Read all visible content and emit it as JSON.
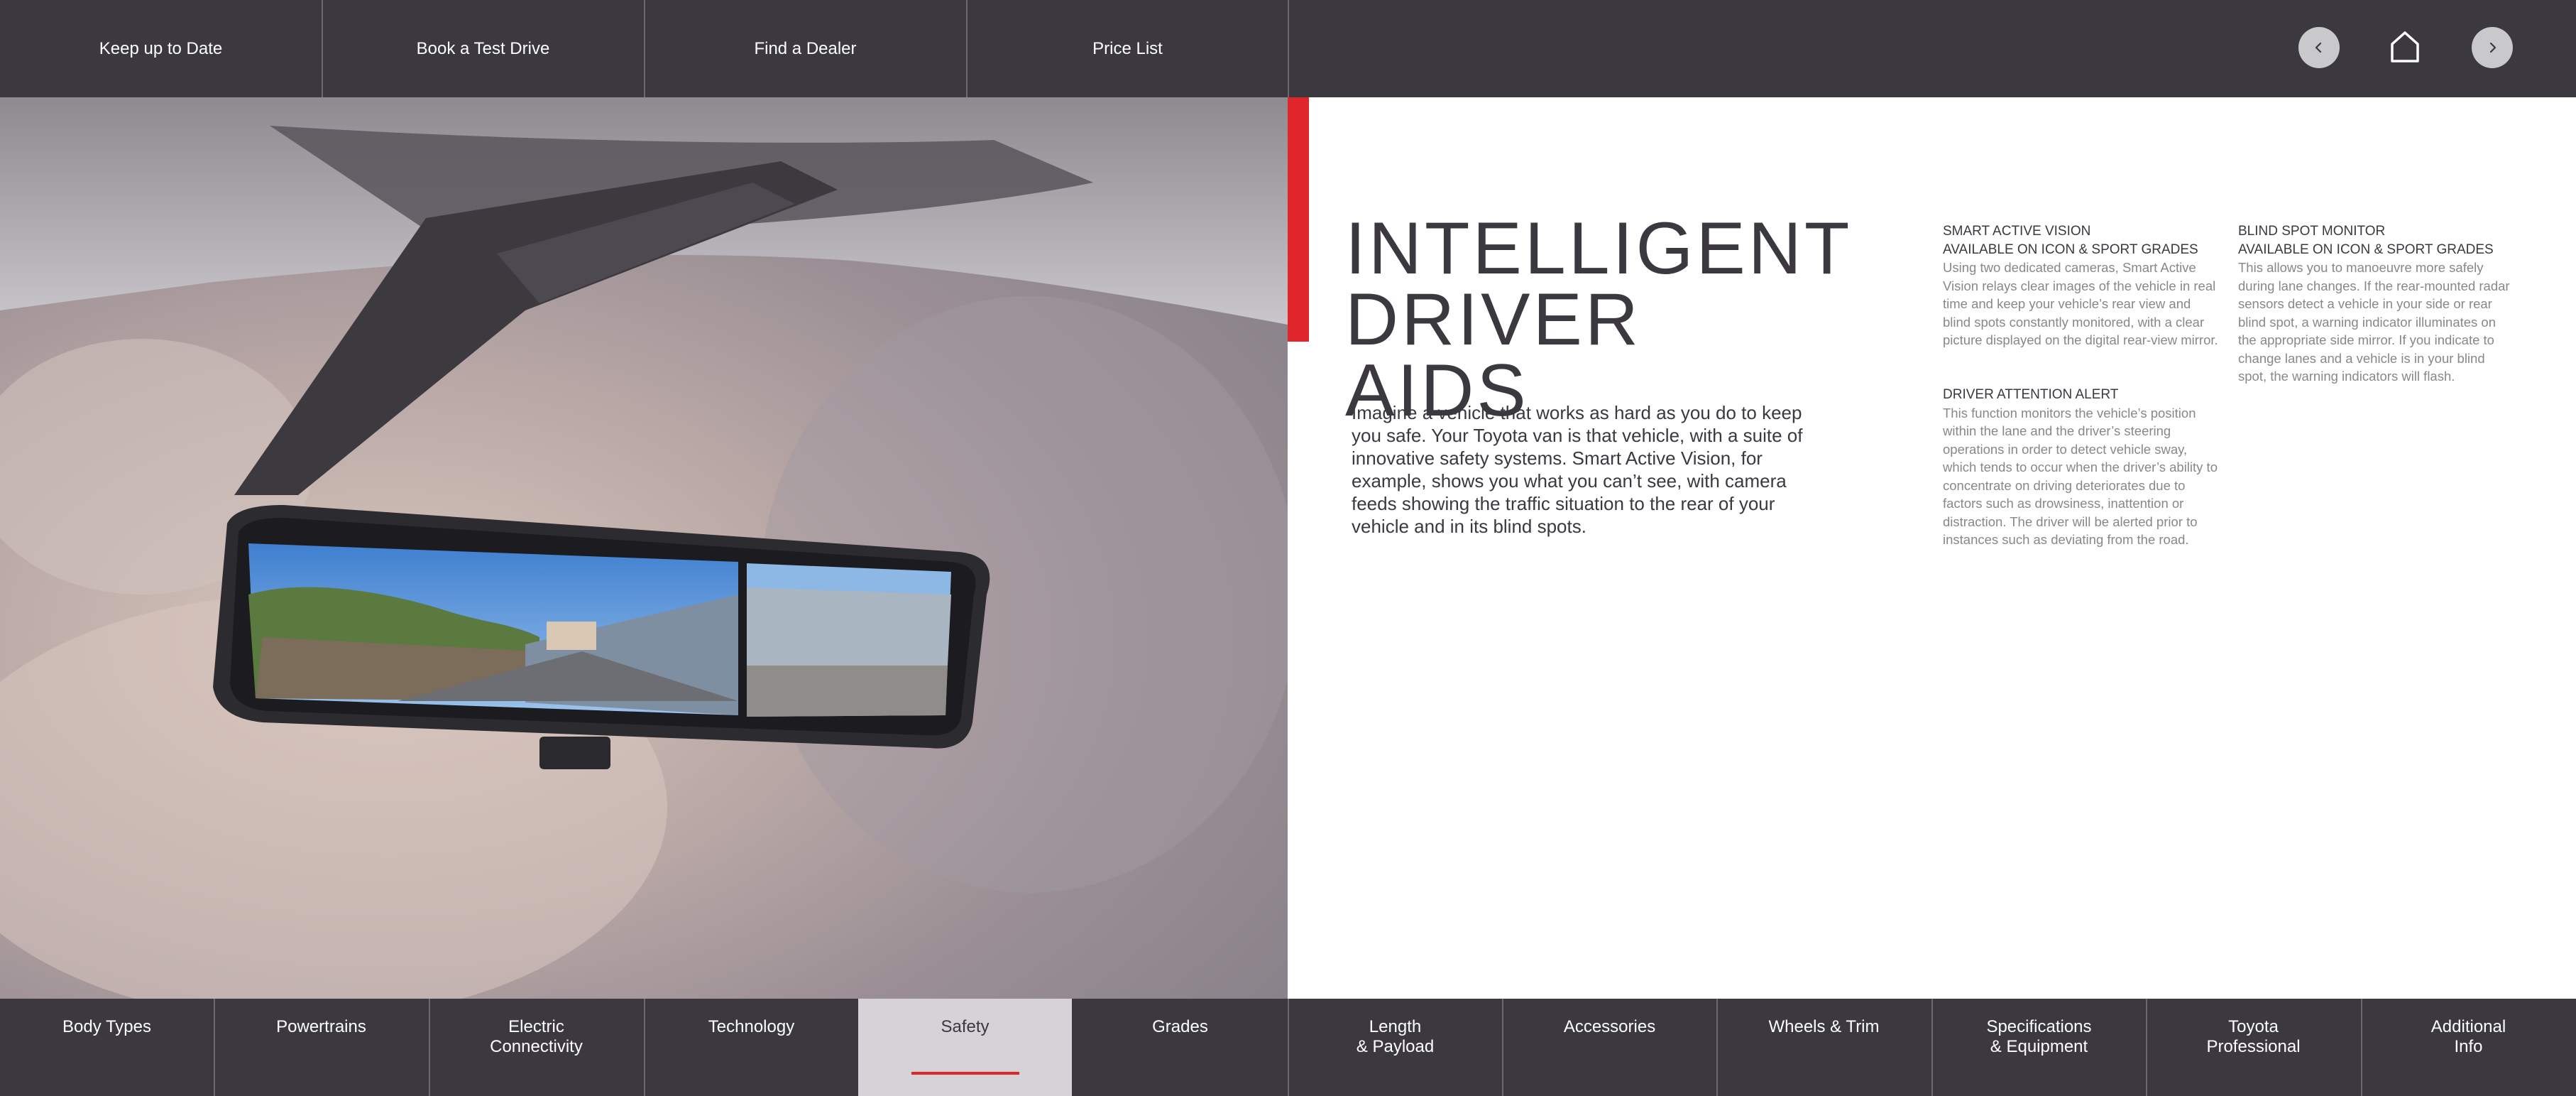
{
  "topnav": {
    "links": [
      "Keep up to Date",
      "Book a Test Drive",
      "Find a Dealer",
      "Price List"
    ]
  },
  "controls": {
    "prev_icon": "chevron-left-icon",
    "home_icon": "home-icon",
    "next_icon": "chevron-right-icon"
  },
  "colors": {
    "bar_bg": "#3b3840",
    "accent_red": "#e0262b",
    "active_tab_bg": "#d5d3d7"
  },
  "content": {
    "title_line1": "INTELLIGENT",
    "title_line2": "DRIVER AIDS",
    "intro": "Imagine a vehicle that works as hard as you do to keep you safe. Your Toyota van is that vehicle, with a suite of innovative safety systems. Smart Active Vision, for example, shows you what you can’t see, with camera feeds showing the traffic situation to the rear of your vehicle and in its blind spots.",
    "features": [
      {
        "heading1": "SMART ACTIVE VISION",
        "heading2": "AVAILABLE ON ICON & SPORT GRADES",
        "body": "Using two dedicated cameras, Smart Active Vision relays clear images of the vehicle in real time and keep your vehicle’s rear view and blind spots constantly monitored, with a clear picture displayed on the digital rear-view mirror."
      },
      {
        "heading1": "DRIVER ATTENTION ALERT",
        "body": "This function monitors the vehicle’s position within the lane and the driver’s steering operations in order to detect vehicle sway, which tends to occur when the driver’s ability to concentrate on driving deteriorates due to factors such as drowsiness, inattention or distraction. The driver will be alerted prior to instances such as deviating from the road."
      },
      {
        "heading1": "BLIND SPOT MONITOR",
        "heading2": "AVAILABLE ON ICON & SPORT GRADES",
        "body": "This allows you to manoeuvre more safely during lane changes. If the rear-mounted radar sensors detect a vehicle in your side or rear blind spot, a warning indicator illuminates on the appropriate side mirror. If you indicate to change lanes and a vehicle is in your blind spot, the warning indicators will flash."
      }
    ]
  },
  "bottomnav": {
    "items": [
      {
        "line1": "Body Types",
        "line2": ""
      },
      {
        "line1": "Powertrains",
        "line2": ""
      },
      {
        "line1": "Electric",
        "line2": "Connectivity"
      },
      {
        "line1": "Technology",
        "line2": ""
      },
      {
        "line1": "Safety",
        "line2": ""
      },
      {
        "line1": "Grades",
        "line2": ""
      },
      {
        "line1": "Length",
        "line2": "& Payload"
      },
      {
        "line1": "Accessories",
        "line2": ""
      },
      {
        "line1": "Wheels & Trim",
        "line2": ""
      },
      {
        "line1": "Specifications",
        "line2": "& Equipment"
      },
      {
        "line1": "Toyota",
        "line2": "Professional"
      },
      {
        "line1": "Additional",
        "line2": "Info"
      }
    ],
    "active": "Safety"
  }
}
